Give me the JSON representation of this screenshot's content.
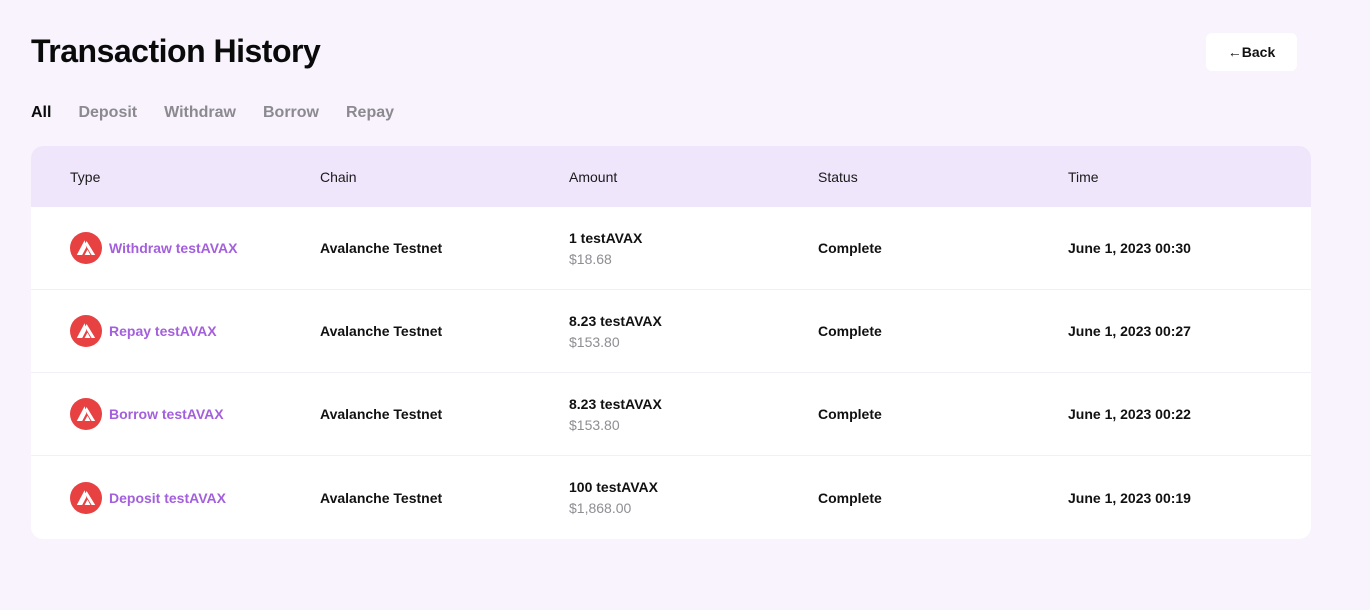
{
  "page": {
    "title": "Transaction History",
    "back_label": "←Back"
  },
  "tabs": [
    {
      "label": "All",
      "active": true
    },
    {
      "label": "Deposit",
      "active": false
    },
    {
      "label": "Withdraw",
      "active": false
    },
    {
      "label": "Borrow",
      "active": false
    },
    {
      "label": "Repay",
      "active": false
    }
  ],
  "table": {
    "headers": {
      "type": "Type",
      "chain": "Chain",
      "amount": "Amount",
      "status": "Status",
      "time": "Time"
    },
    "rows": [
      {
        "type": "Withdraw testAVAX",
        "chain": "Avalanche Testnet",
        "amount": "1 testAVAX",
        "usd": "$18.68",
        "status": "Complete",
        "time": "June 1, 2023 00:30",
        "icon": "avalanche-icon"
      },
      {
        "type": "Repay testAVAX",
        "chain": "Avalanche Testnet",
        "amount": "8.23 testAVAX",
        "usd": "$153.80",
        "status": "Complete",
        "time": "June 1, 2023 00:27",
        "icon": "avalanche-icon"
      },
      {
        "type": "Borrow testAVAX",
        "chain": "Avalanche Testnet",
        "amount": "8.23 testAVAX",
        "usd": "$153.80",
        "status": "Complete",
        "time": "June 1, 2023 00:22",
        "icon": "avalanche-icon"
      },
      {
        "type": "Deposit testAVAX",
        "chain": "Avalanche Testnet",
        "amount": "100 testAVAX",
        "usd": "$1,868.00",
        "status": "Complete",
        "time": "June 1, 2023 00:19",
        "icon": "avalanche-icon"
      }
    ]
  },
  "colors": {
    "background": "#f8f3fd",
    "header_bg": "#f0e6fb",
    "type_link": "#a35fdc",
    "avax_red": "#e84142",
    "muted": "#8e8e93"
  }
}
